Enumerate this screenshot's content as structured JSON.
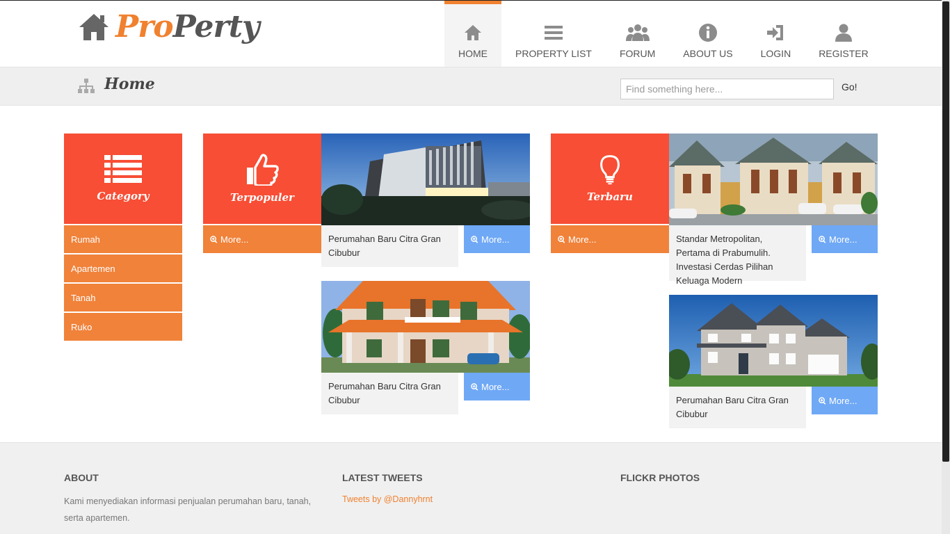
{
  "brand": {
    "part1": "Pro",
    "part2": "Perty"
  },
  "nav": {
    "items": [
      {
        "label": "HOME",
        "icon": "home-icon",
        "active": true
      },
      {
        "label": "PROPERTY LIST",
        "icon": "list-icon"
      },
      {
        "label": "FORUM",
        "icon": "users-icon"
      },
      {
        "label": "ABOUT US",
        "icon": "info-icon"
      },
      {
        "label": "LOGIN",
        "icon": "login-icon"
      },
      {
        "label": "REGISTER",
        "icon": "user-icon"
      }
    ]
  },
  "breadcrumb": {
    "title": "Home",
    "icon": "sitemap-icon"
  },
  "search": {
    "placeholder": "Find something here...",
    "value": "",
    "go_label": "Go!"
  },
  "category": {
    "title": "Category",
    "icon": "list-icon",
    "items": [
      "Rumah",
      "Apartemen",
      "Tanah",
      "Ruko"
    ]
  },
  "terpopuler": {
    "title": "Terpopuler",
    "icon": "thumbs-up-icon",
    "more_label": "More...",
    "listings": [
      {
        "caption": "Perumahan Baru Citra Gran Cibubur",
        "more_label": "More..."
      },
      {
        "caption": "Perumahan Baru Citra Gran Cibubur",
        "more_label": "More..."
      }
    ]
  },
  "terbaru": {
    "title": "Terbaru",
    "icon": "lightbulb-icon",
    "more_label": "More...",
    "listings": [
      {
        "caption": "Standar Metropolitan, Pertama di Prabumulih. Investasi Cerdas Pilihan Keluaga Modern",
        "more_label": "More..."
      },
      {
        "caption": "Perumahan Baru Citra Gran Cibubur",
        "more_label": "More..."
      }
    ]
  },
  "footer": {
    "about": {
      "heading": "ABOUT",
      "text": "Kami menyediakan informasi penjualan perumahan baru, tanah, serta apartemen."
    },
    "tweets": {
      "heading": "LATEST TWEETS",
      "link": "Tweets by @Dannyhrnt"
    },
    "flickr": {
      "heading": "FLICKR PHOTOS"
    }
  },
  "colors": {
    "accent_orange": "#f0812f",
    "tile_red": "#f74e35",
    "more_blue": "#6fa8f5",
    "text_dark": "#555555"
  }
}
